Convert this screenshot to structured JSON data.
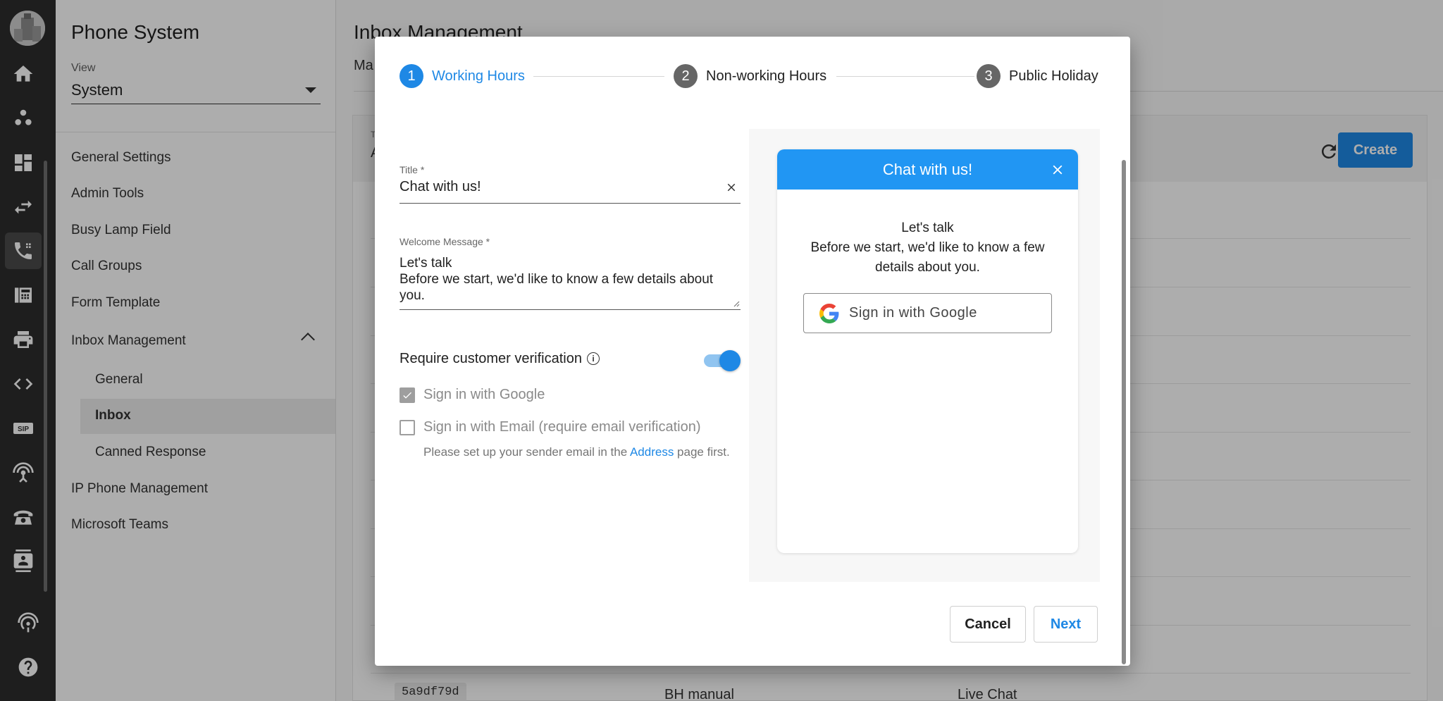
{
  "sidebar": {
    "title": "Phone System",
    "view_label": "View",
    "view_value": "System",
    "items": [
      {
        "label": "General Settings"
      },
      {
        "label": "Admin Tools"
      },
      {
        "label": "Busy Lamp Field"
      },
      {
        "label": "Call Groups"
      },
      {
        "label": "Form Template"
      },
      {
        "label": "Inbox Management"
      },
      {
        "label": "IP Phone Management"
      },
      {
        "label": "Microsoft Teams"
      }
    ],
    "subitems": [
      {
        "label": "General"
      },
      {
        "label": "Inbox"
      },
      {
        "label": "Canned Response"
      }
    ]
  },
  "rail_icons": [
    "home-icon",
    "contacts-icon",
    "dashboard-icon",
    "transfer-icon",
    "phone-icon",
    "fax-icon",
    "printer-icon",
    "code-icon",
    "sip-icon",
    "antenna-icon",
    "telephone-icon",
    "directory-icon",
    "broadcast-icon",
    "help-icon"
  ],
  "main": {
    "title": "Inbox Management",
    "tabs_partial": "Ma",
    "create_label": "Create",
    "filter_label_partial": "T",
    "filter_value_partial": "A",
    "row": {
      "id": "5a9df79d",
      "name": "BH manual",
      "type": "Live Chat"
    }
  },
  "dialog": {
    "steps": [
      {
        "num": "1",
        "label": "Working Hours"
      },
      {
        "num": "2",
        "label": "Non-working Hours"
      },
      {
        "num": "3",
        "label": "Public Holiday"
      }
    ],
    "title_label": "Title *",
    "title_value": "Chat with us!",
    "welcome_label": "Welcome Message *",
    "welcome_line1": "Let's talk",
    "welcome_line2": "Before we start, we'd like to know a few details about you.",
    "verification_label": "Require customer verification",
    "google_option": "Sign in with Google",
    "email_option": "Sign in with Email (require email verification)",
    "hint_before": "Please set up your sender email in the ",
    "hint_link": "Address",
    "hint_after": " page first.",
    "cancel_label": "Cancel",
    "next_label": "Next"
  },
  "preview": {
    "header": "Chat with us!",
    "message_line1": "Let's talk",
    "message_line2": "Before we start, we'd like to know a few details about you.",
    "google_button": "Sign in with Google"
  },
  "colors": {
    "accent": "#1e88e5",
    "widget_header": "#2196f3",
    "rail": "#2d2d2d"
  }
}
